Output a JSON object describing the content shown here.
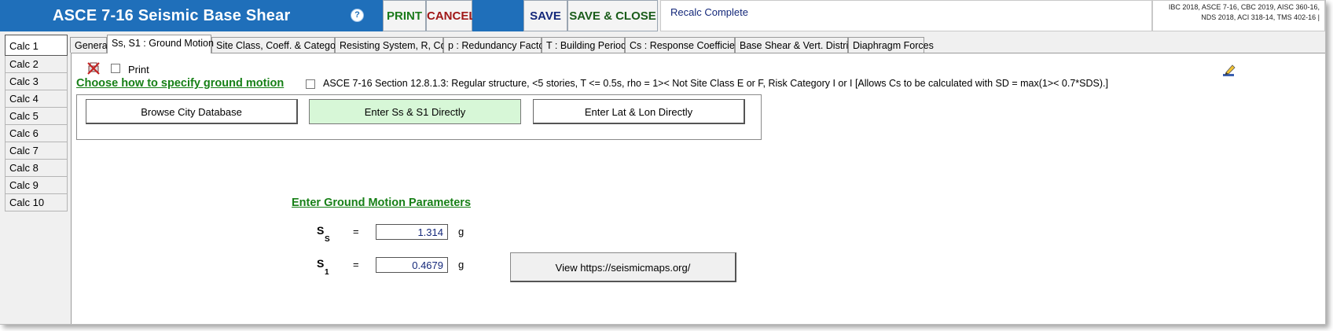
{
  "header": {
    "title": "ASCE 7-16 Seismic Base Shear",
    "help_icon": "?",
    "print_label": "PRINT",
    "cancel_label": "CANCEL",
    "save_label": "SAVE",
    "save_close_label": "SAVE & CLOSE",
    "status": "Recalc Complete",
    "codes": "IBC 2018, ASCE 7-16, CBC 2019, AISC 360-16, NDS 2018, ACI 318-14, TMS 402-16 |",
    "colors": {
      "title_bar": "#1f6fba",
      "print": "#1b7a1b",
      "cancel": "#a01818",
      "save": "#14287a",
      "save_close": "#1a5c1a"
    }
  },
  "calcs": [
    "Calc 1",
    "Calc 2",
    "Calc 3",
    "Calc 4",
    "Calc 5",
    "Calc 6",
    "Calc 7",
    "Calc 8",
    "Calc 9",
    "Calc 10"
  ],
  "active_calc": "Calc 1",
  "tabs": [
    "General",
    "Ss, S1 : Ground Motion",
    "Site Class, Coeff. & Category",
    "Resisting System,  R,  Cd",
    "p : Redundancy Factor",
    "T : Building Period",
    "Cs : Response Coefficient",
    "Base Shear & Vert. Distrib.",
    "Diaphragm Forces"
  ],
  "active_tab": "Ss, S1 : Ground Motion",
  "content": {
    "print_checkbox_label": "Print",
    "choose_heading": "Choose how to specify ground motion",
    "asce_option": "ASCE 7-16 Section 12.8.1.3: Regular structure, <5 stories, T <= 0.5s, rho = 1>< Not Site Class E or F, Risk Category I or I [Allows Cs to be calculated with SD = max(1>< 0.7*SDS).]",
    "buttons": {
      "browse": "Browse City Database",
      "ss_direct": "Enter Ss & S1 Directly",
      "latlon": "Enter Lat & Lon Directly"
    },
    "gm_heading": "Enter Ground Motion Parameters",
    "ss": {
      "symbol": "S",
      "sub": "S",
      "eq": "=",
      "value": "1.314",
      "unit": "g"
    },
    "s1": {
      "symbol": "S",
      "sub": "1",
      "eq": "=",
      "value": "0.4679",
      "unit": "g"
    },
    "maps_button": "View https://seismicmaps.org/",
    "colors": {
      "heading": "#178017",
      "selected_choice": "#d7f7d7",
      "value_text": "#14287a"
    },
    "icons": [
      "no-print-icon",
      "edit-pencil-icon",
      "help-icon"
    ]
  }
}
